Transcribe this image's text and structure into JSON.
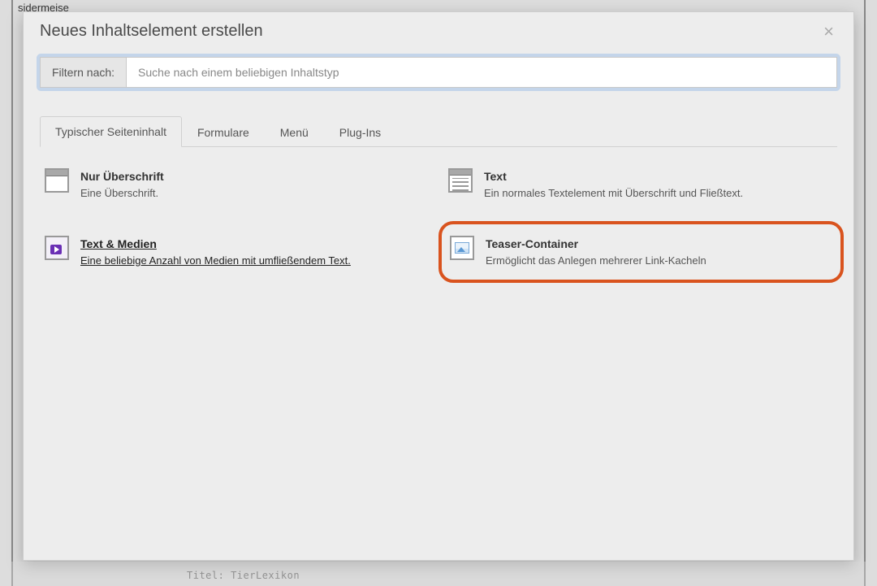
{
  "background": {
    "top_left_fragment": "sidermeise",
    "bottom_fragment": "Titel: TierLexikon"
  },
  "modal": {
    "title": "Neues Inhaltselement erstellen",
    "close_label": "×",
    "filter": {
      "label": "Filtern nach:",
      "placeholder": "Suche nach einem beliebigen Inhaltstyp"
    },
    "tabs": [
      {
        "label": "Typischer Seiteninhalt",
        "active": true
      },
      {
        "label": "Formulare",
        "active": false
      },
      {
        "label": "Menü",
        "active": false
      },
      {
        "label": "Plug-Ins",
        "active": false
      }
    ],
    "elements": [
      {
        "title": "Nur Überschrift",
        "desc": "Eine Überschrift.",
        "icon": "header-icon",
        "hovered": false,
        "highlight": false
      },
      {
        "title": "Text",
        "desc": "Ein normales Textelement mit Überschrift und Fließtext.",
        "icon": "text-icon",
        "hovered": false,
        "highlight": false
      },
      {
        "title": "Text & Medien",
        "desc": "Eine beliebige Anzahl von Medien mit umfließendem Text.",
        "icon": "media-icon",
        "hovered": true,
        "highlight": false
      },
      {
        "title": "Teaser-Container",
        "desc": "Ermöglicht das Anlegen mehrerer Link-Kacheln",
        "icon": "image-icon",
        "hovered": false,
        "highlight": true
      }
    ]
  }
}
